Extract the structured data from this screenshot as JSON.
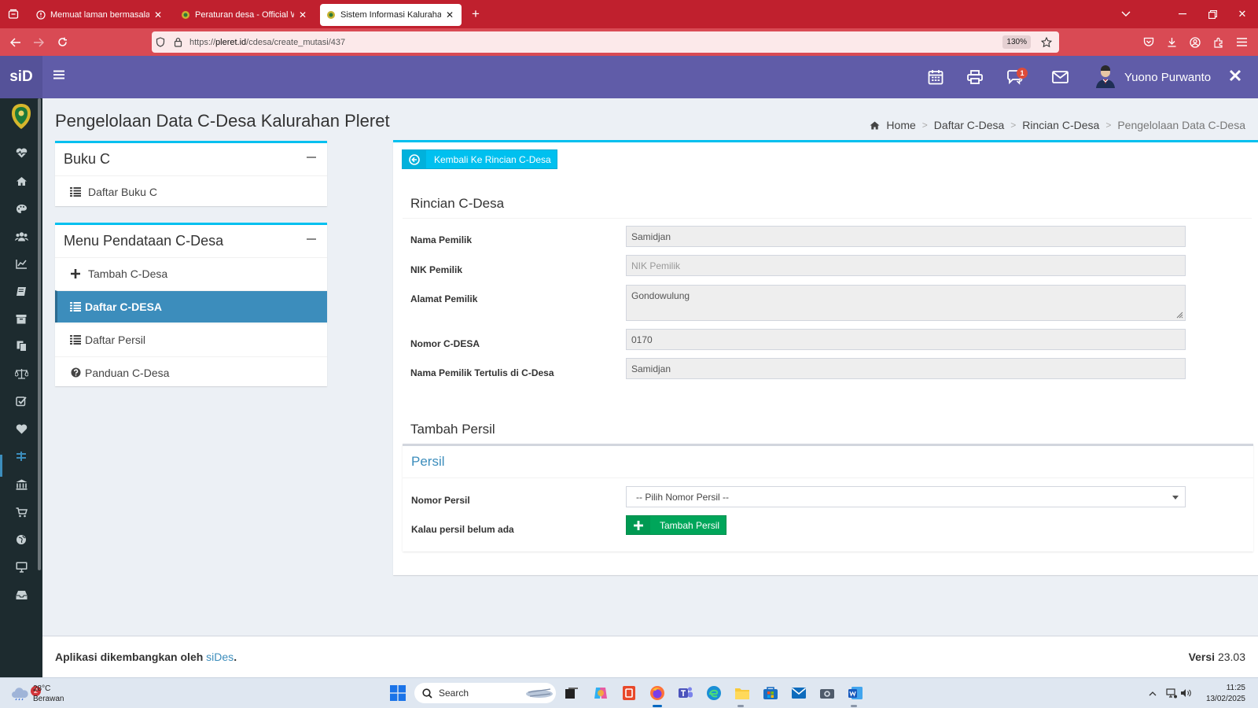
{
  "browser": {
    "tabs": [
      {
        "title": "Memuat laman bermasalah",
        "active": false
      },
      {
        "title": "Peraturan desa - Official Websit",
        "active": false
      },
      {
        "title": "Sistem Informasi Kalurahan Pler",
        "active": true
      }
    ],
    "url_prefix": "https://",
    "url_host": "pleret.id",
    "url_path": "/cdesa/create_mutasi/437",
    "zoom": "130%"
  },
  "header": {
    "brand": "siD",
    "notification_count": "1",
    "user_name": "Yuono Purwanto",
    "colors": {
      "header": "#605ca8",
      "brand": "#555299"
    }
  },
  "sidebar_icons": [
    "dashboard-heart-icon",
    "home-icon",
    "palette-icon",
    "users-icon",
    "line-chart-icon",
    "book-icon",
    "archive-icon",
    "copy-icon",
    "balance-icon",
    "check-square-icon",
    "heart-icon",
    "money-icon",
    "bank-icon",
    "cart-icon",
    "globe-icon",
    "desktop-icon",
    "inbox-icon"
  ],
  "page": {
    "title": "Pengelolaan Data C-Desa Kalurahan Pleret",
    "breadcrumb": {
      "home": "Home",
      "items": [
        "Daftar C-Desa",
        "Rincian C-Desa"
      ],
      "current": "Pengelolaan Data C-Desa"
    }
  },
  "buku_c_box": {
    "title": "Buku C",
    "items": [
      "Daftar Buku C"
    ]
  },
  "menu_box": {
    "title": "Menu Pendataan C-Desa",
    "items": [
      {
        "label": "Tambah C-Desa",
        "icon": "plus-icon",
        "active": false
      },
      {
        "label": "Daftar C-DESA",
        "icon": "list-icon",
        "active": true
      },
      {
        "label": "Daftar Persil",
        "icon": "list-icon",
        "active": false
      },
      {
        "label": "Panduan C-Desa",
        "icon": "question-circle-icon",
        "active": false
      }
    ]
  },
  "main": {
    "back_button": "Kembali Ke Rincian C-Desa",
    "rincian_title": "Rincian C-Desa",
    "fields": {
      "nama_pemilik": {
        "label": "Nama Pemilik",
        "value": "Samidjan"
      },
      "nik_pemilik": {
        "label": "NIK Pemilik",
        "placeholder": "NIK Pemilik"
      },
      "alamat_pemilik": {
        "label": "Alamat Pemilik",
        "value": "Gondowulung"
      },
      "nomor_cdesa": {
        "label": "Nomor C-DESA",
        "value": "0170"
      },
      "nama_tertulis": {
        "label": "Nama Pemilik Tertulis di C-Desa",
        "value": "Samidjan"
      }
    },
    "tambah_persil_title": "Tambah Persil",
    "persil": {
      "title": "Persil",
      "nomor_label": "Nomor Persil",
      "select_value": "-- Pilih Nomor Persil --",
      "belum_ada_label": "Kalau persil belum ada",
      "add_button": "Tambah Persil"
    }
  },
  "footer": {
    "left_text": "Aplikasi dikembangkan oleh",
    "link": "siDes",
    "period": ".",
    "version_label": "Versi",
    "version": "23.03"
  },
  "taskbar": {
    "weather_alerts": "2",
    "temperature": "28°C",
    "weather": "Berawan",
    "search_label": "Search",
    "time": "11:25",
    "date": "13/02/2025"
  },
  "colors": {
    "accent_info": "#00c0ef",
    "accent_primary": "#3c8dbc",
    "success": "#00a65a",
    "tabbar": "#c0202e"
  }
}
